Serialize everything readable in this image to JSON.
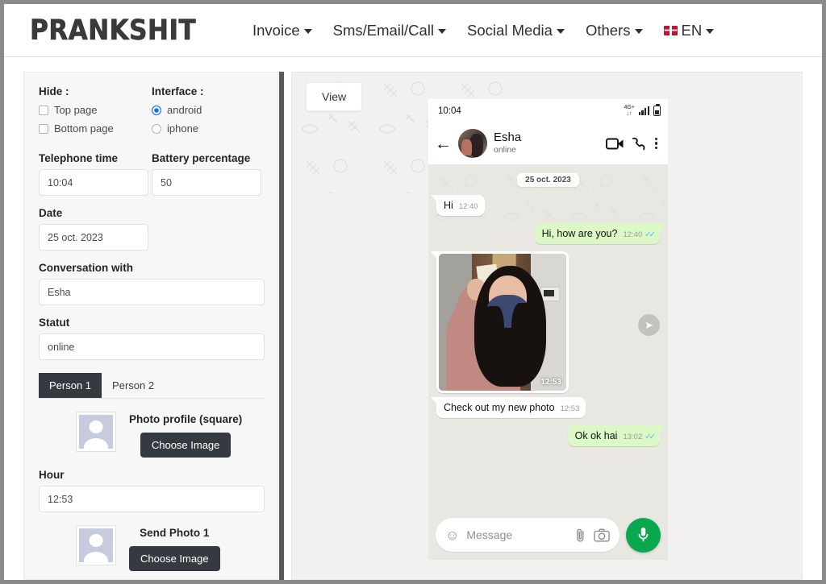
{
  "nav": {
    "brand": "PRANKSHIT",
    "items": [
      {
        "label": "Invoice",
        "caret": true
      },
      {
        "label": "Sms/Email/Call",
        "caret": true
      },
      {
        "label": "Social Media",
        "caret": true
      },
      {
        "label": "Others",
        "caret": true
      }
    ],
    "language": {
      "label": "EN",
      "flag_icon": "uk-flag-icon",
      "caret": true
    }
  },
  "sidebar": {
    "hide": {
      "label": "Hide :",
      "options": [
        {
          "label": "Top page",
          "checked": false
        },
        {
          "label": "Bottom page",
          "checked": false
        }
      ]
    },
    "interface": {
      "label": "Interface :",
      "options": [
        {
          "label": "android",
          "selected": true
        },
        {
          "label": "iphone",
          "selected": false
        }
      ]
    },
    "telephone_time": {
      "label": "Telephone time",
      "value": "10:04"
    },
    "battery_percentage": {
      "label": "Battery percentage",
      "value": "50"
    },
    "date": {
      "label": "Date",
      "value": "25 oct. 2023"
    },
    "conversation_with": {
      "label": "Conversation with",
      "value": "Esha"
    },
    "statut": {
      "label": "Statut",
      "value": "online"
    },
    "tabs": [
      {
        "label": "Person 1",
        "active": true
      },
      {
        "label": "Person 2",
        "active": false
      }
    ],
    "photo_profile": {
      "label": "Photo profile (square)",
      "button": "Choose Image"
    },
    "hour": {
      "label": "Hour",
      "value": "12:53"
    },
    "send_photo_1": {
      "label": "Send Photo 1"
    }
  },
  "preview": {
    "view_button": "View",
    "phone": {
      "status_bar": {
        "time": "10:04",
        "network": "4G+",
        "network_arrows": "↓↑",
        "signal_icon": "signal-bars-icon",
        "battery_icon": "battery-icon"
      },
      "header": {
        "back_icon": "back-arrow-icon",
        "avatar": "contact-avatar",
        "name": "Esha",
        "status": "online",
        "video_icon": "video-call-icon",
        "call_icon": "voice-call-icon",
        "menu_icon": "more-options-icon"
      },
      "date_chip": "25 oct. 2023",
      "messages": [
        {
          "type": "text",
          "side": "in",
          "text": "Hi",
          "time": "12:40",
          "ticks": false
        },
        {
          "type": "text",
          "side": "out",
          "text": "Hi, how are you?",
          "time": "12:40",
          "ticks": true
        },
        {
          "type": "image",
          "side": "in",
          "time": "12:53",
          "forward_icon": "forward-icon"
        },
        {
          "type": "text",
          "side": "in",
          "text": "Check out my new photo",
          "time": "12:53",
          "ticks": false
        },
        {
          "type": "text",
          "side": "out",
          "text": "Ok ok hai",
          "time": "13:02",
          "ticks": true
        }
      ],
      "composer": {
        "emoji_icon": "emoji-icon",
        "placeholder": "Message",
        "attach_icon": "attachment-icon",
        "camera_icon": "camera-icon",
        "mic_icon": "microphone-icon"
      }
    }
  },
  "colors": {
    "outgoing_bubble": "#dcf8c6",
    "incoming_bubble": "#ffffff",
    "chat_background": "#e9e7e2",
    "mic_green": "#09a84e",
    "tick_blue": "#4fc3f7",
    "dark_button": "#343a40",
    "radio_blue": "#0d6efd"
  }
}
